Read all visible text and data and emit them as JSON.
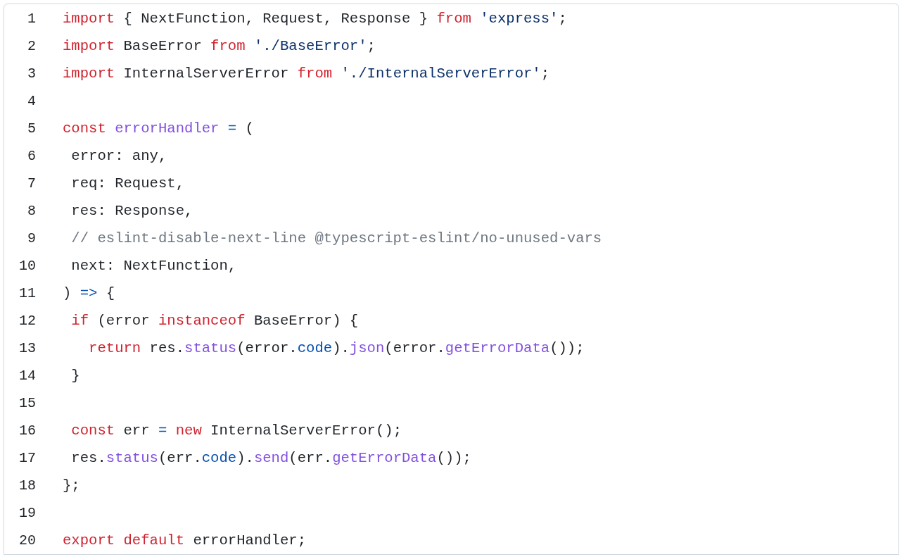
{
  "code_lines": [
    {
      "number": "1",
      "tokens": [
        {
          "kind": "keyword",
          "text": "import"
        },
        {
          "kind": "plain",
          "text": " { NextFunction, Request, Response } "
        },
        {
          "kind": "keyword",
          "text": "from"
        },
        {
          "kind": "string",
          "text": " 'express'"
        },
        {
          "kind": "plain",
          "text": ";"
        }
      ]
    },
    {
      "number": "2",
      "tokens": [
        {
          "kind": "keyword",
          "text": "import"
        },
        {
          "kind": "plain",
          "text": " BaseError "
        },
        {
          "kind": "keyword",
          "text": "from"
        },
        {
          "kind": "string",
          "text": " './BaseError'"
        },
        {
          "kind": "plain",
          "text": ";"
        }
      ]
    },
    {
      "number": "3",
      "tokens": [
        {
          "kind": "keyword",
          "text": "import"
        },
        {
          "kind": "plain",
          "text": " InternalServerError "
        },
        {
          "kind": "keyword",
          "text": "from"
        },
        {
          "kind": "string",
          "text": " './InternalServerError'"
        },
        {
          "kind": "plain",
          "text": ";"
        }
      ]
    },
    {
      "number": "4"
    },
    {
      "number": "5",
      "tokens": [
        {
          "kind": "keyword",
          "text": "const"
        },
        {
          "kind": "function",
          "text": " errorHandler"
        },
        {
          "kind": "operator",
          "text": " ="
        },
        {
          "kind": "plain",
          "text": " ("
        }
      ]
    },
    {
      "number": "6",
      "tokens": [
        {
          "kind": "plain",
          "text": " error: any,"
        }
      ]
    },
    {
      "number": "7",
      "tokens": [
        {
          "kind": "plain",
          "text": " req: Request,"
        }
      ]
    },
    {
      "number": "8",
      "tokens": [
        {
          "kind": "plain",
          "text": " res: Response,"
        }
      ]
    },
    {
      "number": "9",
      "tokens": [
        {
          "kind": "comment",
          "text": " // eslint-disable-next-line @typescript-eslint/no-unused-vars"
        }
      ]
    },
    {
      "number": "10",
      "tokens": [
        {
          "kind": "plain",
          "text": " next: NextFunction,"
        }
      ]
    },
    {
      "number": "11",
      "tokens": [
        {
          "kind": "plain",
          "text": ") "
        },
        {
          "kind": "operator",
          "text": "=>"
        },
        {
          "kind": "plain",
          "text": " {"
        }
      ]
    },
    {
      "number": "12",
      "tokens": [
        {
          "kind": "keyword",
          "text": " if"
        },
        {
          "kind": "plain",
          "text": " (error "
        },
        {
          "kind": "keyword",
          "text": "instanceof"
        },
        {
          "kind": "plain",
          "text": " BaseError) {"
        }
      ]
    },
    {
      "number": "13",
      "tokens": [
        {
          "kind": "keyword",
          "text": "   return"
        },
        {
          "kind": "plain",
          "text": " res."
        },
        {
          "kind": "function",
          "text": "status"
        },
        {
          "kind": "plain",
          "text": "(error."
        },
        {
          "kind": "operator",
          "text": "code"
        },
        {
          "kind": "plain",
          "text": ")."
        },
        {
          "kind": "function",
          "text": "json"
        },
        {
          "kind": "plain",
          "text": "(error."
        },
        {
          "kind": "function",
          "text": "getErrorData"
        },
        {
          "kind": "plain",
          "text": "());"
        }
      ]
    },
    {
      "number": "14",
      "tokens": [
        {
          "kind": "plain",
          "text": " }"
        }
      ]
    },
    {
      "number": "15"
    },
    {
      "number": "16",
      "tokens": [
        {
          "kind": "keyword",
          "text": " const"
        },
        {
          "kind": "plain",
          "text": " err "
        },
        {
          "kind": "operator",
          "text": "="
        },
        {
          "kind": "keyword",
          "text": " new"
        },
        {
          "kind": "plain",
          "text": " InternalServerError();"
        }
      ]
    },
    {
      "number": "17",
      "tokens": [
        {
          "kind": "plain",
          "text": " res."
        },
        {
          "kind": "function",
          "text": "status"
        },
        {
          "kind": "plain",
          "text": "(err."
        },
        {
          "kind": "operator",
          "text": "code"
        },
        {
          "kind": "plain",
          "text": ")."
        },
        {
          "kind": "function",
          "text": "send"
        },
        {
          "kind": "plain",
          "text": "(err."
        },
        {
          "kind": "function",
          "text": "getErrorData"
        },
        {
          "kind": "plain",
          "text": "());"
        }
      ]
    },
    {
      "number": "18",
      "tokens": [
        {
          "kind": "plain",
          "text": "};"
        }
      ]
    },
    {
      "number": "19"
    },
    {
      "number": "20",
      "tokens": [
        {
          "kind": "keyword",
          "text": "export"
        },
        {
          "kind": "keyword",
          "text": " default"
        },
        {
          "kind": "plain",
          "text": " errorHandler;"
        }
      ]
    }
  ]
}
